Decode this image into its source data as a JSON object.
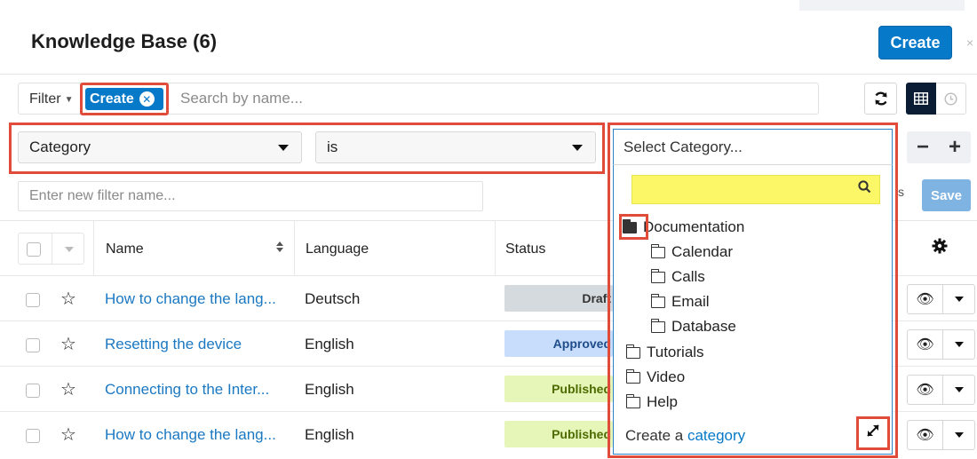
{
  "header": {
    "title": "Knowledge Base (6)",
    "create_label": "Create",
    "close_glyph": "×"
  },
  "filter_bar": {
    "filter_label": "Filter",
    "active_pill_label": "Create",
    "search_placeholder": "Search by name...",
    "refresh_icon": "refresh-icon",
    "grid_icon": "grid-view-icon",
    "clock_icon": "activity-stream-icon"
  },
  "filter_row": {
    "field_select": "Category",
    "operator_select": "is",
    "value_placeholder": "Select Category...",
    "minus_label": "−",
    "plus_label": "+"
  },
  "category_dropdown": {
    "search_value": "",
    "tree": [
      {
        "label": "Documentation",
        "open": true,
        "level": 0
      },
      {
        "label": "Calendar",
        "open": false,
        "level": 1
      },
      {
        "label": "Calls",
        "open": false,
        "level": 1
      },
      {
        "label": "Email",
        "open": false,
        "level": 1
      },
      {
        "label": "Database",
        "open": false,
        "level": 1
      },
      {
        "label": "Tutorials",
        "open": false,
        "level": 0
      },
      {
        "label": "Video",
        "open": false,
        "level": 0
      },
      {
        "label": "Help",
        "open": false,
        "level": 0
      }
    ],
    "footer_prefix": "Create a ",
    "footer_link": "category"
  },
  "filter_name": {
    "placeholder": "Enter new filter name...",
    "save_label": "Save"
  },
  "table": {
    "columns": {
      "name": "Name",
      "language": "Language",
      "status": "Status"
    },
    "rows": [
      {
        "name": "How to change the lang...",
        "language": "Deutsch",
        "status": "Draft",
        "status_kind": "draft"
      },
      {
        "name": "Resetting the device",
        "language": "English",
        "status": "Approved",
        "status_kind": "approved"
      },
      {
        "name": "Connecting to the Inter...",
        "language": "English",
        "status": "Published",
        "status_kind": "published"
      },
      {
        "name": "How to change the lang...",
        "language": "English",
        "status": "Published",
        "status_kind": "published"
      }
    ]
  },
  "colors": {
    "primary": "#0679c8",
    "highlight": "#e04b3a",
    "search_fill": "#fbf766"
  }
}
